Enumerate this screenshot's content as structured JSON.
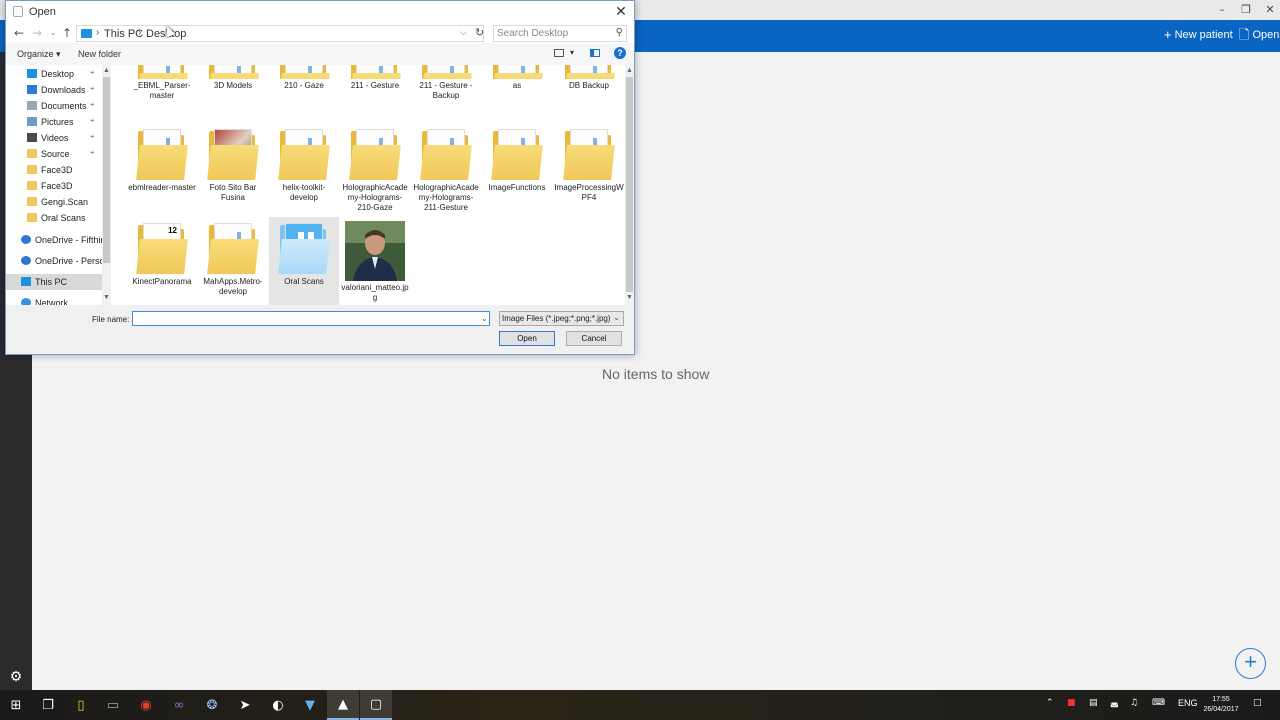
{
  "app": {
    "new_patient_label": "New patient",
    "open_label": "Open",
    "empty_message": "No items to show",
    "brand_color": "#0a64c2"
  },
  "dialog": {
    "title": "Open",
    "breadcrumb": [
      "This PC",
      "Desktop"
    ],
    "search_placeholder": "Search Desktop",
    "toolbar": {
      "organize": "Organize",
      "new_folder": "New folder"
    },
    "nav_items": [
      {
        "label": "Desktop",
        "icon": "desktop-icon",
        "pinned": true
      },
      {
        "label": "Downloads",
        "icon": "download-icon",
        "pinned": true
      },
      {
        "label": "Documents",
        "icon": "documents-icon",
        "pinned": true
      },
      {
        "label": "Pictures",
        "icon": "pictures-icon",
        "pinned": true
      },
      {
        "label": "Videos",
        "icon": "videos-icon",
        "pinned": true
      },
      {
        "label": "Source",
        "icon": "folder-icon",
        "pinned": true
      },
      {
        "label": "Face3D",
        "icon": "folder-icon",
        "pinned": false
      },
      {
        "label": "Face3D",
        "icon": "folder-icon",
        "pinned": false
      },
      {
        "label": "Gengi.Scan",
        "icon": "folder-icon",
        "pinned": false
      },
      {
        "label": "Oral Scans",
        "icon": "folder-icon",
        "pinned": false
      },
      {
        "label": "OneDrive - Fifthin",
        "icon": "onedrive-icon",
        "pinned": false
      },
      {
        "label": "OneDrive - Persor",
        "icon": "onedrive-icon",
        "pinned": false
      },
      {
        "label": "This PC",
        "icon": "pc-icon",
        "pinned": false,
        "selected": true
      },
      {
        "label": "Network",
        "icon": "network-icon",
        "pinned": false
      }
    ],
    "files": [
      {
        "name": "_EBML_Parser-master",
        "type": "folder"
      },
      {
        "name": "3D Models",
        "type": "folder"
      },
      {
        "name": "210 - Gaze",
        "type": "folder"
      },
      {
        "name": "211 - Gesture",
        "type": "folder"
      },
      {
        "name": "211 - Gesture - Backup",
        "type": "folder"
      },
      {
        "name": "as",
        "type": "folder"
      },
      {
        "name": "DB Backup",
        "type": "folder"
      },
      {
        "name": "ebmlreader-master",
        "type": "folder"
      },
      {
        "name": "Foto Sito Bar Fusina",
        "type": "photo-folder"
      },
      {
        "name": "helix-toolkit-develop",
        "type": "folder"
      },
      {
        "name": "HolographicAcademy-Holograms-210-Gaze",
        "type": "folder"
      },
      {
        "name": "HolographicAcademy-Holograms-211-Gesture",
        "type": "folder"
      },
      {
        "name": "ImageFunctions",
        "type": "folder"
      },
      {
        "name": "ImageProcessingWPF4",
        "type": "folder"
      },
      {
        "name": "KinectPanorama",
        "type": "vs-folder"
      },
      {
        "name": "MahApps.Metro-develop",
        "type": "folder"
      },
      {
        "name": "Oral Scans",
        "type": "app-folder",
        "selected": true
      },
      {
        "name": "valoriani_matteo.jpg",
        "type": "image"
      }
    ],
    "file_name_label": "File name:",
    "file_name_value": "",
    "filter": "Image Files  (*.jpeg;*.png;*.jpg)",
    "open_button": "Open",
    "cancel_button": "Cancel"
  },
  "taskbar": {
    "apps": [
      "windows-start-icon",
      "task-view-icon",
      "file-explorer-icon",
      "notepad-icon",
      "chrome-icon",
      "visual-studio-icon",
      "app-icon",
      "unity-icon",
      "ccleaner-icon",
      "app-icon",
      "photo-app-icon",
      "dialog-app-icon"
    ],
    "language": "ENG",
    "time": "17:55",
    "date": "26/04/2017"
  }
}
